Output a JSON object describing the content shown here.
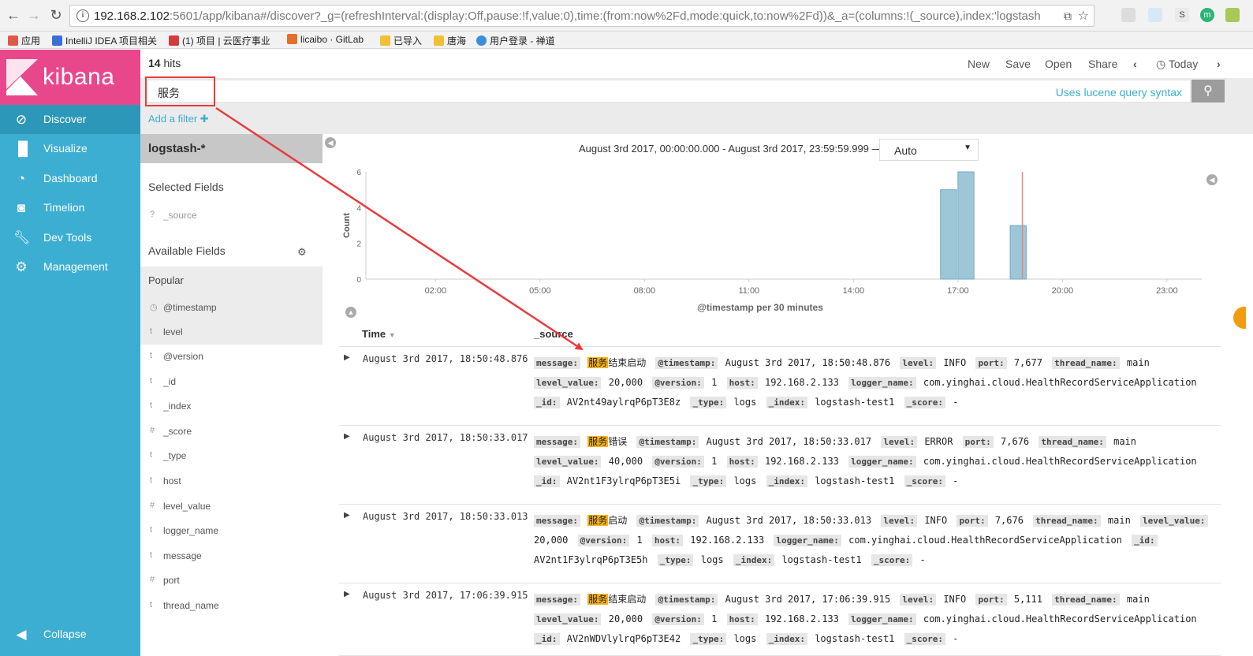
{
  "browser": {
    "url_main": "192.168.2.102",
    "url_rest": ":5601/app/kibana#/discover?_g=(refreshInterval:(display:Off,pause:!f,value:0),time:(from:now%2Fd,mode:quick,to:now%2Fd))&_a=(columns:!(_source),index:'logstash-*',int",
    "bookmarks": [
      {
        "label": "应用",
        "color": "#e0584a"
      },
      {
        "label": "IntelliJ IDEA 项目相关",
        "color": "#3a6fd8"
      },
      {
        "label": "(1) 项目 | 云医疗事业",
        "color": "#d23c3c"
      },
      {
        "label": "licaibo · GitLab",
        "color": "#e2702a"
      },
      {
        "label": "已导入",
        "color": "#f2c037"
      },
      {
        "label": "唐海",
        "color": "#f2c037"
      },
      {
        "label": "用户登录 - 禅道",
        "color": "#3b8ed9"
      }
    ],
    "extensions": [
      {
        "label": "S",
        "bg": "#e9e9e9",
        "fg": "#444"
      },
      {
        "label": "m",
        "bg": "#2bb673",
        "fg": "#fff"
      }
    ]
  },
  "sidebar": {
    "logo": "kibana",
    "items": [
      {
        "label": "Discover",
        "icon": "compass-icon"
      },
      {
        "label": "Visualize",
        "icon": "bar-chart-icon"
      },
      {
        "label": "Dashboard",
        "icon": "dashboard-icon"
      },
      {
        "label": "Timelion",
        "icon": "timelion-icon"
      },
      {
        "label": "Dev Tools",
        "icon": "wrench-icon"
      },
      {
        "label": "Management",
        "icon": "gear-icon"
      }
    ],
    "collapse": "Collapse"
  },
  "topbar": {
    "hits_count": "14",
    "hits_label": "hits",
    "menu": [
      "New",
      "Save",
      "Open",
      "Share"
    ],
    "time_label": "Today"
  },
  "query": {
    "value": "服务",
    "lucene_link": "Uses lucene query syntax",
    "add_filter": "Add a filter"
  },
  "fields": {
    "index_pattern": "logstash-*",
    "selected_title": "Selected Fields",
    "selected": [
      {
        "type": "?",
        "name": "_source"
      }
    ],
    "available_title": "Available Fields",
    "popular_title": "Popular",
    "popular": [
      {
        "type": "◷",
        "name": "@timestamp"
      },
      {
        "type": "t",
        "name": "level"
      }
    ],
    "others": [
      {
        "type": "t",
        "name": "@version"
      },
      {
        "type": "t",
        "name": "_id"
      },
      {
        "type": "t",
        "name": "_index"
      },
      {
        "type": "#",
        "name": "_score"
      },
      {
        "type": "t",
        "name": "_type"
      },
      {
        "type": "t",
        "name": "host"
      },
      {
        "type": "#",
        "name": "level_value"
      },
      {
        "type": "t",
        "name": "logger_name"
      },
      {
        "type": "t",
        "name": "message"
      },
      {
        "type": "#",
        "name": "port"
      },
      {
        "type": "t",
        "name": "thread_name"
      }
    ]
  },
  "chart": {
    "range_text": "August 3rd 2017, 00:00:00.000 - August 3rd 2017, 23:59:59.999 —",
    "interval": "Auto"
  },
  "chart_data": {
    "type": "bar",
    "ylabel": "Count",
    "xlabel": "@timestamp per 30 minutes",
    "ylim": [
      0,
      6
    ],
    "yticks": [
      0,
      2,
      4,
      6
    ],
    "xticks": [
      "02:00",
      "05:00",
      "08:00",
      "11:00",
      "14:00",
      "17:00",
      "20:00",
      "23:00"
    ],
    "x_hours": [
      0,
      24
    ],
    "bars": [
      {
        "start_hour": 16.5,
        "value": 5
      },
      {
        "start_hour": 17.0,
        "value": 6
      },
      {
        "start_hour": 18.5,
        "value": 3
      }
    ],
    "now_marker_hour": 18.85,
    "bar_color": "#9dc7d6",
    "bar_border": "#6eaabf",
    "marker_color": "#e08888"
  },
  "docs": {
    "columns": [
      "Time",
      "_source"
    ],
    "rows": [
      {
        "time": "August 3rd 2017, 18:50:48.876",
        "hl": "服务",
        "msg_rest": "结束启动",
        "pairs1": [
          [
            "@timestamp:",
            "August 3rd 2017, 18:50:48.876"
          ],
          [
            "level:",
            "INFO"
          ],
          [
            "port:",
            "7,677"
          ],
          [
            "thread_name:",
            "main"
          ],
          [
            "level_value:",
            "20,000"
          ]
        ],
        "pairs2": [
          [
            "@version:",
            "1"
          ],
          [
            "host:",
            "192.168.2.133"
          ],
          [
            "logger_name:",
            "com.yinghai.cloud.HealthRecordServiceApplication"
          ],
          [
            "_id:",
            "AV2nt49aylrqP6pT3E8z"
          ]
        ],
        "pairs3": [
          [
            "_type:",
            "logs"
          ],
          [
            "_index:",
            "logstash-test1"
          ],
          [
            "_score:",
            "-"
          ]
        ]
      },
      {
        "time": "August 3rd 2017, 18:50:33.017",
        "hl": "服务",
        "msg_rest": "错误",
        "pairs1": [
          [
            "@timestamp:",
            "August 3rd 2017, 18:50:33.017"
          ],
          [
            "level:",
            "ERROR"
          ],
          [
            "port:",
            "7,676"
          ],
          [
            "thread_name:",
            "main"
          ],
          [
            "level_value:",
            "40,000"
          ]
        ],
        "pairs2": [
          [
            "@version:",
            "1"
          ],
          [
            "host:",
            "192.168.2.133"
          ],
          [
            "logger_name:",
            "com.yinghai.cloud.HealthRecordServiceApplication"
          ],
          [
            "_id:",
            "AV2nt1F3ylrqP6pT3E5i"
          ]
        ],
        "pairs3": [
          [
            "_type:",
            "logs"
          ],
          [
            "_index:",
            "logstash-test1"
          ],
          [
            "_score:",
            "-"
          ]
        ]
      },
      {
        "time": "August 3rd 2017, 18:50:33.013",
        "hl": "服务",
        "msg_rest": "启动",
        "pairs1": [
          [
            "@timestamp:",
            "August 3rd 2017, 18:50:33.013"
          ],
          [
            "level:",
            "INFO"
          ],
          [
            "port:",
            "7,676"
          ],
          [
            "thread_name:",
            "main"
          ],
          [
            "level_value:",
            "20,000"
          ]
        ],
        "pairs2": [
          [
            "@version:",
            "1"
          ],
          [
            "host:",
            "192.168.2.133"
          ],
          [
            "logger_name:",
            "com.yinghai.cloud.HealthRecordServiceApplication"
          ],
          [
            "_id:",
            "AV2nt1F3ylrqP6pT3E5h"
          ]
        ],
        "pairs3": [
          [
            "_type:",
            "logs"
          ],
          [
            "_index:",
            "logstash-test1"
          ],
          [
            "_score:",
            "-"
          ]
        ]
      },
      {
        "time": "August 3rd 2017, 17:06:39.915",
        "hl": "服务",
        "msg_rest": "结束启动",
        "pairs1": [
          [
            "@timestamp:",
            "August 3rd 2017, 17:06:39.915"
          ],
          [
            "level:",
            "INFO"
          ],
          [
            "port:",
            "5,111"
          ],
          [
            "thread_name:",
            "main"
          ],
          [
            "level_value:",
            "20,000"
          ]
        ],
        "pairs2": [
          [
            "@version:",
            "1"
          ],
          [
            "host:",
            "192.168.2.133"
          ],
          [
            "logger_name:",
            "com.yinghai.cloud.HealthRecordServiceApplication"
          ],
          [
            "_id:",
            "AV2nWDVlylrqP6pT3E42"
          ]
        ],
        "pairs3": [
          [
            "_type:",
            "logs"
          ],
          [
            "_index:",
            "logstash-test1"
          ],
          [
            "_score:",
            "-"
          ]
        ]
      }
    ]
  },
  "annotation_color": "#e83b3b"
}
